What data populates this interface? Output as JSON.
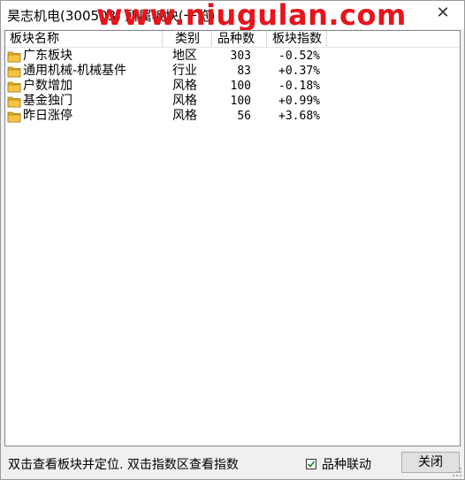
{
  "window": {
    "title": "昊志机电(300503) 所属板块(一览)",
    "watermark": "www.niugulan.com",
    "close_glyph": "✕"
  },
  "list": {
    "headers": [
      "板块名称",
      "类别",
      "品种数",
      "板块指数"
    ],
    "rows": [
      {
        "name": "广东板块",
        "category": "地区",
        "count": "303",
        "index": "-0.52%"
      },
      {
        "name": "通用机械-机械基件",
        "category": "行业",
        "count": "83",
        "index": "+0.37%"
      },
      {
        "name": "户数增加",
        "category": "风格",
        "count": "100",
        "index": "-0.18%"
      },
      {
        "name": "基金独门",
        "category": "风格",
        "count": "100",
        "index": "+0.99%"
      },
      {
        "name": "昨日涨停",
        "category": "风格",
        "count": "56",
        "index": "+3.68%"
      }
    ],
    "row_icon": "folder-icon"
  },
  "footer": {
    "hint": "双击查看板块并定位. 双击指数区查看指数",
    "checkbox_label": "品种联动",
    "checkbox_checked": true,
    "close_button": "关闭"
  },
  "colors": {
    "watermark": "#e8141c",
    "folder": "#f5c542",
    "check": "#1a7f2e"
  }
}
